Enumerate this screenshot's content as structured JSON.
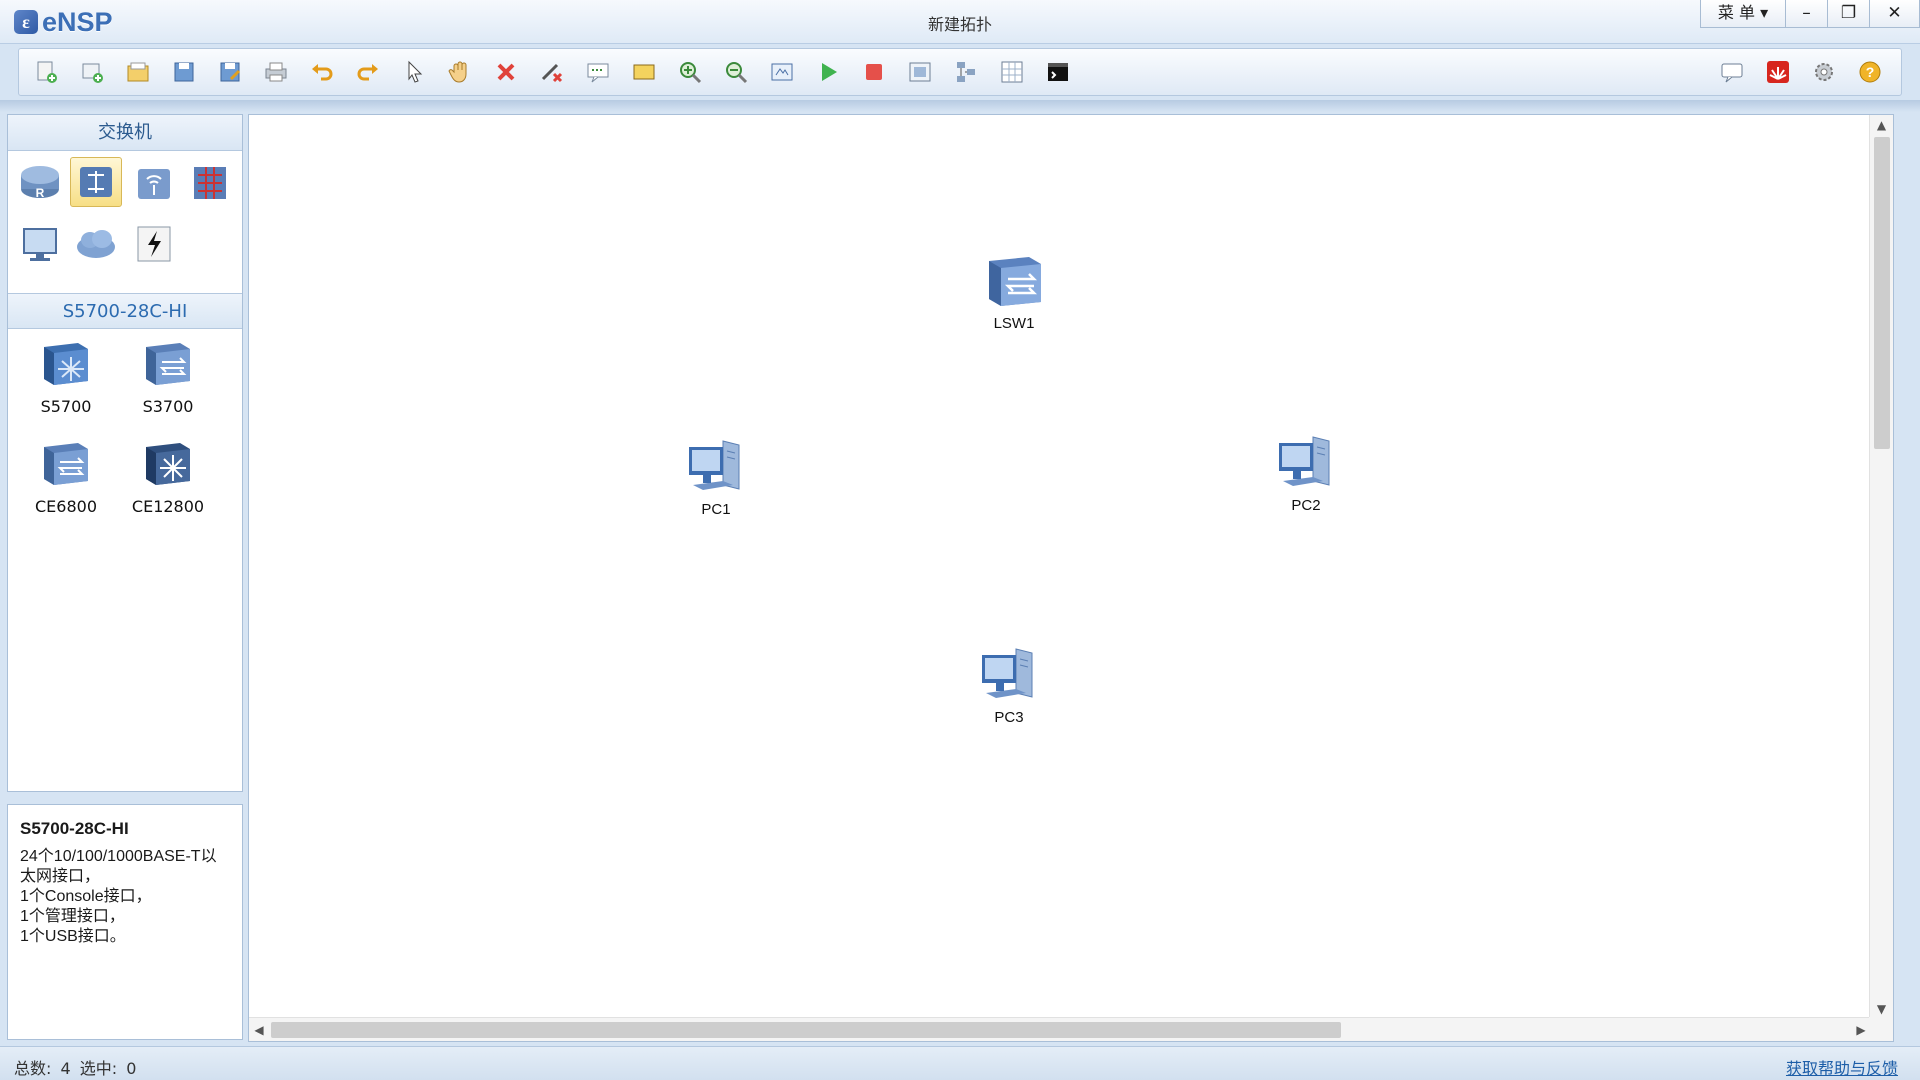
{
  "app": {
    "name": "eNSP",
    "window_title": "新建拓扑",
    "menu_label": "菜 单",
    "controls": {
      "minimize": "–",
      "restore": "❐",
      "close": "✕"
    }
  },
  "toolbar": {
    "left_icons": [
      "new-topology-icon",
      "new-page-icon",
      "open-icon",
      "save-icon",
      "save-as-icon",
      "print-icon",
      "undo-icon",
      "redo-icon",
      "select-pointer-icon",
      "hand-pan-icon",
      "delete-icon",
      "delete-link-icon",
      "text-comment-icon",
      "rectangle-icon",
      "zoom-in-icon",
      "zoom-out-icon",
      "fit-view-icon",
      "start-device-icon",
      "stop-device-icon",
      "capture-icon",
      "topology-icon",
      "grid-icon",
      "cli-icon"
    ],
    "right_icons": [
      "message-icon",
      "huawei-icon",
      "settings-icon",
      "help-icon"
    ]
  },
  "device_panel": {
    "category_title": "交换机",
    "categories": [
      "router",
      "switch",
      "wireless",
      "firewall",
      "pc",
      "cloud",
      "power"
    ],
    "selected_category": "switch",
    "model_title": "S5700-28C-HI",
    "devices": [
      {
        "label": "S5700"
      },
      {
        "label": "S3700"
      },
      {
        "label": "CE6800"
      },
      {
        "label": "CE12800"
      }
    ]
  },
  "description": {
    "title": "S5700-28C-HI",
    "lines": [
      "24个10/100/1000BASE-T以",
      "太网接口，",
      "1个Console接口，",
      "1个管理接口，",
      "1个USB接口。"
    ]
  },
  "topology": {
    "nodes": [
      {
        "label": "LSW1",
        "type": "switch"
      },
      {
        "label": "PC1",
        "type": "pc"
      },
      {
        "label": "PC2",
        "type": "pc"
      },
      {
        "label": "PC3",
        "type": "pc"
      }
    ]
  },
  "status": {
    "total_label": "总数:",
    "total_value": "4",
    "selected_label": "选中:",
    "selected_value": "0",
    "help_link": "获取帮助与反馈"
  }
}
